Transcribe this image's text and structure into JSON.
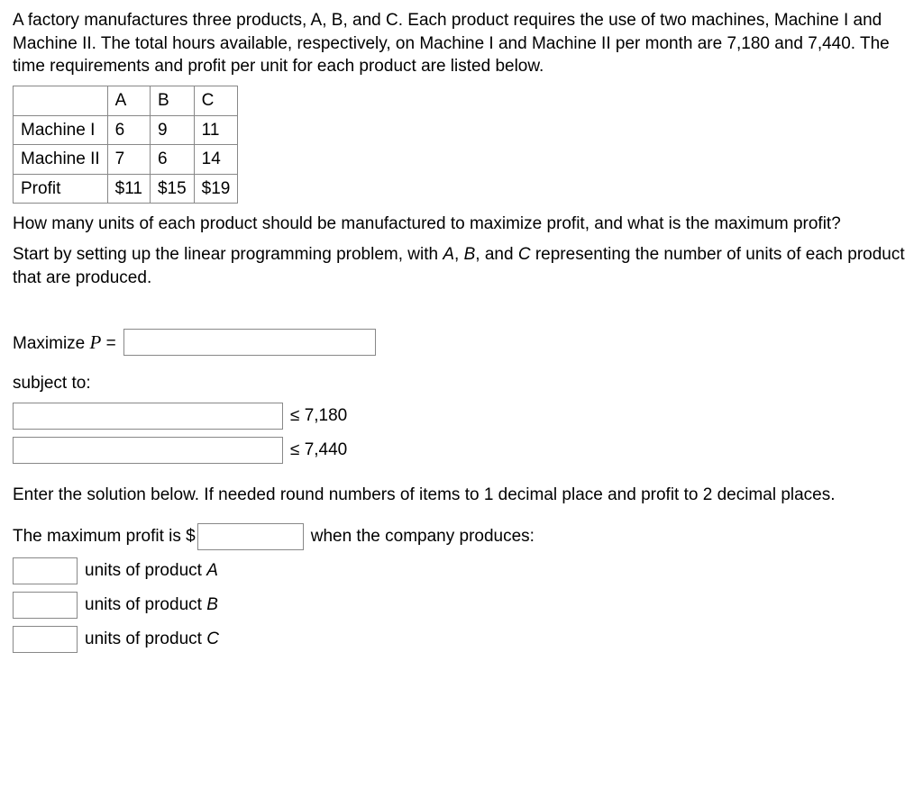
{
  "intro": "A factory manufactures three products, A, B, and C. Each product requires the use of two machines, Machine I and Machine II. The total hours available, respectively, on Machine I and Machine II per month are 7,180 and 7,440. The time requirements and profit per unit for each product are listed below.",
  "table": {
    "headers": [
      "",
      "A",
      "B",
      "C"
    ],
    "rows": [
      {
        "label": "Machine I",
        "A": "6",
        "B": "9",
        "C": "11"
      },
      {
        "label": "Machine II",
        "A": "7",
        "B": "6",
        "C": "14"
      },
      {
        "label": "Profit",
        "A": "$11",
        "B": "$15",
        "C": "$19"
      }
    ]
  },
  "question": "How many units of each product should be manufactured to maximize profit, and what is the maximum profit?",
  "setup_text_prefix": "Start by setting up the linear programming problem, with ",
  "A": "A",
  "B": "B",
  "C": "C",
  "setup_text_and": ", and ",
  "setup_text_suffix": " representing the number of units of each product that are produced.",
  "maximize_label": "Maximize ",
  "P_var": "P",
  "equals": " = ",
  "subject_to": "subject to:",
  "constraint1_rhs": "≤ 7,180",
  "constraint2_rhs": "≤ 7,440",
  "solution_instr": "Enter the solution below. If needed round numbers of items to 1 decimal place and profit to 2 decimal places.",
  "max_profit_prefix": "The maximum profit is $",
  "max_profit_suffix": " when the company produces:",
  "units_A_prefix": " units of product ",
  "units_B_prefix": " units of product ",
  "units_C_prefix": " units of product ",
  "comma_sep": ", "
}
